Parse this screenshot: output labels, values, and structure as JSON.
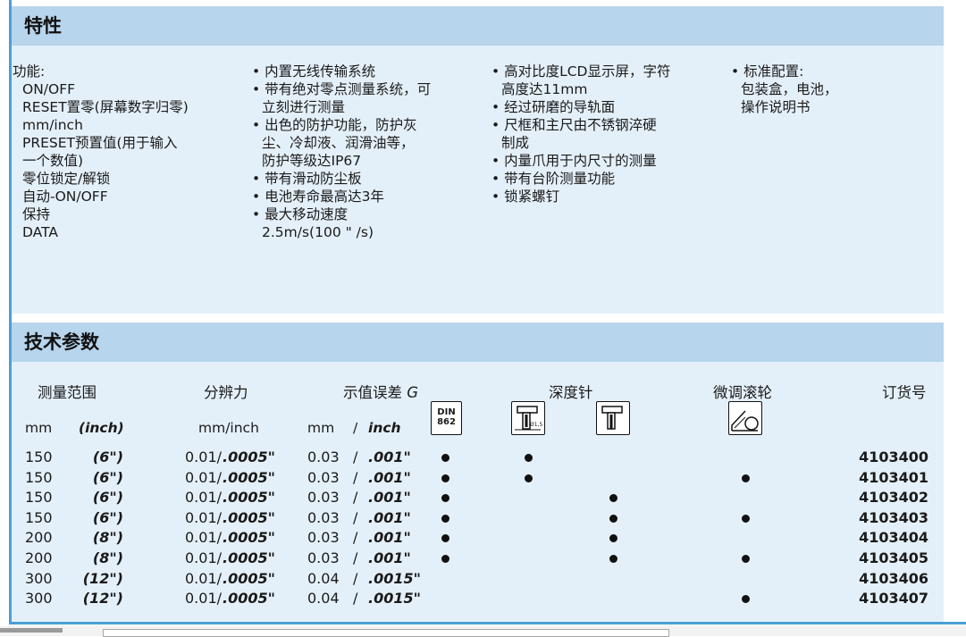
{
  "features": {
    "title": "特性",
    "col1": [
      "功能:",
      "ON/OFF",
      "RESET置零(屏幕数字归零)",
      "mm/inch",
      "PRESET预置值(用于输入",
      "一个数值)",
      "零位锁定/解锁",
      "自动-ON/OFF",
      "保持",
      "DATA"
    ],
    "col2": [
      "• 内置无线传输系统",
      "• 带有绝对零点测量系统，可",
      "立刻进行测量",
      "• 出色的防护功能，防护灰",
      "尘、冷却液、润滑油等，",
      "防护等级达IP67",
      "• 带有滑动防尘板",
      "• 电池寿命最高达3年",
      "• 最大移动速度",
      "2.5m/s(100 \" /s)"
    ],
    "col3": [
      "• 高对比度LCD显示屏，字符",
      "高度达11mm",
      "• 经过研磨的导轨面",
      "• 尺框和主尺由不锈钢淬硬",
      "制成",
      "• 内量爪用于内尺寸的测量",
      "• 带有台阶测量功能",
      "• 锁紧螺钉"
    ],
    "col4": [
      "• 标准配置:",
      "包装盒，电池，",
      "操作说明书"
    ]
  },
  "specs": {
    "title": "技术参数",
    "headers": {
      "range": "测量范围",
      "resolution": "分辨力",
      "error": "示值误差",
      "error_symbol": "G",
      "depth": "深度针",
      "thumbwheel": "微调滚轮",
      "order": "订货号"
    },
    "units": {
      "mm": "mm",
      "inch": "(inch)",
      "res": "mm/inch",
      "err_mm": "mm",
      "slash": "/",
      "err_inch": "inch",
      "din_line1": "DIN",
      "din_line2": "862",
      "depth_icon_label": "Ø1,5"
    },
    "rows": [
      {
        "mm": "150",
        "inch": "(6\")",
        "res": "0.01/",
        "res_inch": ".0005\"",
        "err_mm": "0.03",
        "err_inch": ".001\"",
        "din": true,
        "depth_round": true,
        "depth_flat": false,
        "wheel": false,
        "order": "4103400"
      },
      {
        "mm": "150",
        "inch": "(6\")",
        "res": "0.01/",
        "res_inch": ".0005\"",
        "err_mm": "0.03",
        "err_inch": ".001\"",
        "din": true,
        "depth_round": true,
        "depth_flat": false,
        "wheel": true,
        "order": "4103401"
      },
      {
        "mm": "150",
        "inch": "(6\")",
        "res": "0.01/",
        "res_inch": ".0005\"",
        "err_mm": "0.03",
        "err_inch": ".001\"",
        "din": true,
        "depth_round": false,
        "depth_flat": true,
        "wheel": false,
        "order": "4103402"
      },
      {
        "mm": "150",
        "inch": "(6\")",
        "res": "0.01/",
        "res_inch": ".0005\"",
        "err_mm": "0.03",
        "err_inch": ".001\"",
        "din": true,
        "depth_round": false,
        "depth_flat": true,
        "wheel": true,
        "order": "4103403"
      },
      {
        "mm": "200",
        "inch": "(8\")",
        "res": "0.01/",
        "res_inch": ".0005\"",
        "err_mm": "0.03",
        "err_inch": ".001\"",
        "din": true,
        "depth_round": false,
        "depth_flat": true,
        "wheel": false,
        "order": "4103404"
      },
      {
        "mm": "200",
        "inch": "(8\")",
        "res": "0.01/",
        "res_inch": ".0005\"",
        "err_mm": "0.03",
        "err_inch": ".001\"",
        "din": true,
        "depth_round": false,
        "depth_flat": true,
        "wheel": true,
        "order": "4103405"
      },
      {
        "mm": "300",
        "inch": "(12\")",
        "res": "0.01/",
        "res_inch": ".0005\"",
        "err_mm": "0.04",
        "err_inch": ".0015\"",
        "din": false,
        "depth_round": false,
        "depth_flat": false,
        "wheel": false,
        "order": "4103406"
      },
      {
        "mm": "300",
        "inch": "(12\")",
        "res": "0.01/",
        "res_inch": ".0005\"",
        "err_mm": "0.04",
        "err_inch": ".0015\"",
        "din": false,
        "depth_round": false,
        "depth_flat": false,
        "wheel": true,
        "order": "4103407"
      }
    ]
  },
  "colors": {
    "header_bg": "#b7d5ec",
    "body_bg": "#e4f0f9",
    "accent": "#4a9fd8"
  }
}
